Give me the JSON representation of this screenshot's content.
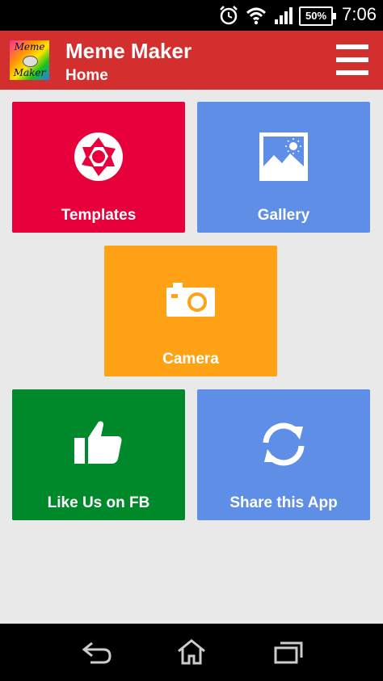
{
  "status_bar": {
    "time": "7:06",
    "battery": "50%",
    "icons": [
      "alarm-icon",
      "wifi-icon",
      "signal-icon",
      "battery-icon"
    ]
  },
  "app_bar": {
    "logo_text_top": "Meme",
    "logo_text_bottom": "Maker",
    "title": "Meme Maker",
    "subtitle": "Home",
    "menu_icon": "hamburger-menu-icon"
  },
  "tiles": [
    {
      "label": "Templates",
      "color": "#e8003c",
      "icon": "aperture-icon"
    },
    {
      "label": "Gallery",
      "color": "#5f8ee6",
      "icon": "image-icon"
    },
    {
      "label": "Camera",
      "color": "#ffa215",
      "icon": "camera-icon"
    },
    {
      "label": "Like Us on FB",
      "color": "#00892a",
      "icon": "thumbs-up-icon"
    },
    {
      "label": "Share this App",
      "color": "#5f8ee6",
      "icon": "refresh-share-icon"
    }
  ],
  "nav_bar": {
    "buttons": [
      "back-icon",
      "home-icon",
      "recent-apps-icon"
    ]
  }
}
